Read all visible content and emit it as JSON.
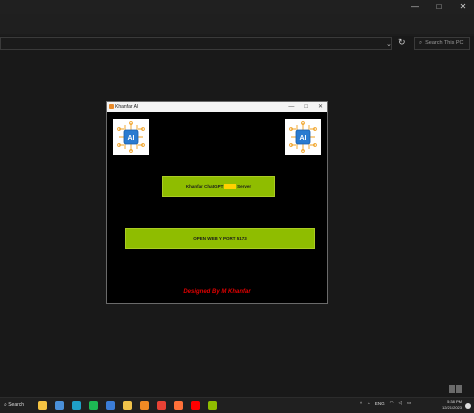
{
  "explorer": {
    "window_controls": [
      "—",
      "□",
      "✕"
    ],
    "search_placeholder": "Search This PC"
  },
  "app": {
    "title": "Khanfar AI",
    "controls": [
      "—",
      "□",
      "✕"
    ],
    "server_button": {
      "before": "Khanfar ChatGPT",
      "highlight": "(ON)",
      "after": "Server"
    },
    "open_button": "OPEN WEB Y PORT 5173",
    "designed_by": "Designed By M Khanfar"
  },
  "taskbar": {
    "search_label": "Search",
    "language": "ENG",
    "time": "5:38 PM",
    "date": "12/21/2023",
    "icons": [
      {
        "name": "explorer-icon",
        "color": "#f5c342"
      },
      {
        "name": "task-view-icon",
        "color": "#4a90d9"
      },
      {
        "name": "edge-icon",
        "color": "#1fa0c8"
      },
      {
        "name": "spotify-icon",
        "color": "#1db954"
      },
      {
        "name": "store-icon",
        "color": "#3b7dd8"
      },
      {
        "name": "folder-icon",
        "color": "#f0c24a"
      },
      {
        "name": "vlc-icon",
        "color": "#f08a24"
      },
      {
        "name": "chrome-icon",
        "color": "#e94235"
      },
      {
        "name": "firefox-icon",
        "color": "#ff7139"
      },
      {
        "name": "youtube-icon",
        "color": "#ff0000"
      },
      {
        "name": "app-icon",
        "color": "#8fbd00"
      }
    ]
  },
  "colors": {
    "accent_green": "#8fbd00",
    "designed_red": "#e00000",
    "highlight_yellow": "#ffd100"
  }
}
